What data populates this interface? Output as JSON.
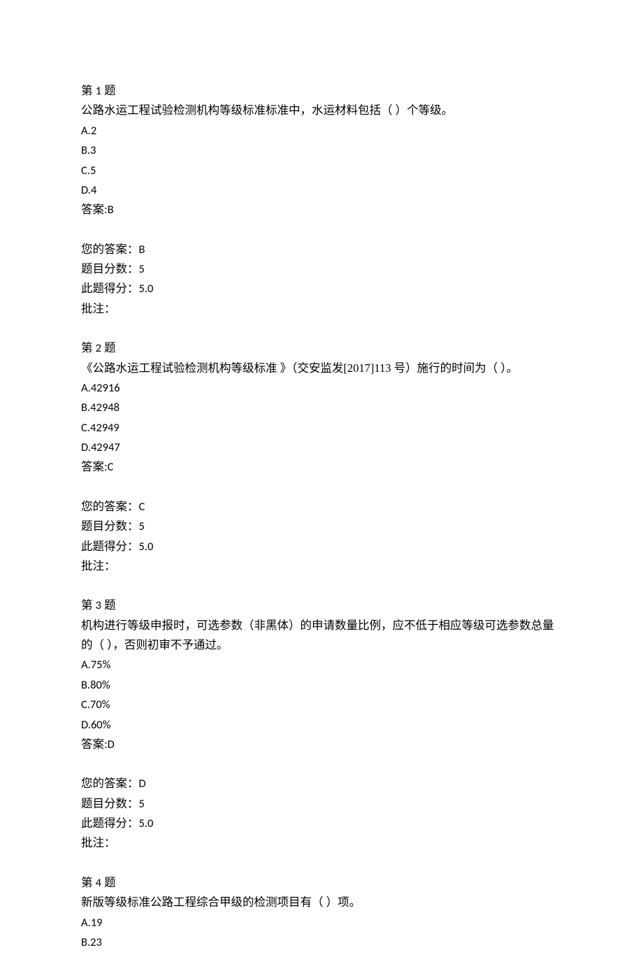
{
  "labels": {
    "question_prefix": "第 ",
    "question_suffix": " 题",
    "answer_prefix": "答案:",
    "your_answer": "您的答案：",
    "question_score": "题目分数：",
    "earned_score": "此题得分：",
    "remark": "批注："
  },
  "questions": [
    {
      "number": "1",
      "stem": "公路水运工程试验检测机构等级标准标准中，水运材料包括（ ）个等级。",
      "options": [
        {
          "label": "A.",
          "text": "2"
        },
        {
          "label": "B.",
          "text": "3"
        },
        {
          "label": "C.",
          "text": "5"
        },
        {
          "label": "D.",
          "text": "4"
        }
      ],
      "answer": "B",
      "your_answer": "B",
      "score": "5",
      "earned": "5.0",
      "remark": ""
    },
    {
      "number": "2",
      "stem": "《公路水运工程试验检测机构等级标准 》（交安监发[2017]113 号）施行的时间为（ ）。",
      "options": [
        {
          "label": "A.",
          "text": "42916"
        },
        {
          "label": "B.",
          "text": "42948"
        },
        {
          "label": "C.",
          "text": "42949"
        },
        {
          "label": "D.",
          "text": "42947"
        }
      ],
      "answer": "C",
      "your_answer": "C",
      "score": "5",
      "earned": "5.0",
      "remark": ""
    },
    {
      "number": "3",
      "stem": "机构进行等级申报时，可选参数（非黑体）的申请数量比例，应不低于相应等级可选参数总量的（ ），否则初审不予通过。",
      "options": [
        {
          "label": "A.",
          "text": "75%"
        },
        {
          "label": "B.",
          "text": "80%"
        },
        {
          "label": "C.",
          "text": "70%"
        },
        {
          "label": "D.",
          "text": "60%"
        }
      ],
      "answer": "D",
      "your_answer": "D",
      "score": "5",
      "earned": "5.0",
      "remark": ""
    },
    {
      "number": "4",
      "stem": "新版等级标准公路工程综合甲级的检测项目有（ ）项。",
      "options": [
        {
          "label": "A.",
          "text": "19"
        },
        {
          "label": "B.",
          "text": "23"
        }
      ],
      "answer": null,
      "your_answer": null,
      "score": null,
      "earned": null,
      "remark": null
    }
  ]
}
